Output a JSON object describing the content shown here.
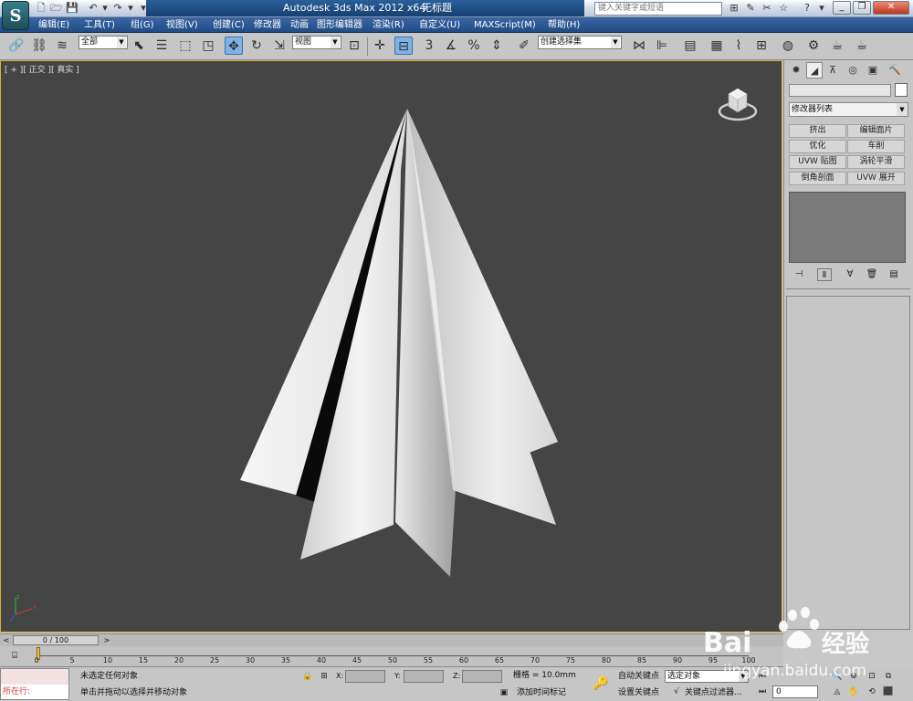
{
  "titlebar": {
    "app": "Autodesk 3ds Max  2012 x64",
    "file": "无标题",
    "search_placeholder": "键入关键字或短语"
  },
  "menu": [
    "编辑(E)",
    "工具(T)",
    "组(G)",
    "视图(V)",
    "创建(C)",
    "修改器",
    "动画",
    "图形编辑器",
    "渲染(R)",
    "自定义(U)",
    "MAXScript(M)",
    "帮助(H)"
  ],
  "toolbar": {
    "selection_filter": "全部",
    "ref_coord": "视图",
    "named_selection": "创建选择集",
    "snap_angle_label": "3"
  },
  "viewport": {
    "label": "[ + ][ 正交 ][ 真实 ]"
  },
  "command_panel": {
    "modifier_list": "修改器列表",
    "buttons": [
      "挤出",
      "编辑面片",
      "优化",
      "车削",
      "UVW 贴图",
      "涡轮平滑",
      "倒角剖面",
      "UVW 展开"
    ]
  },
  "timeline": {
    "frame_counter": "0 / 100",
    "ruler_labels": [
      "0",
      "5",
      "10",
      "15",
      "20",
      "25",
      "30",
      "35",
      "40",
      "45",
      "50",
      "55",
      "60",
      "65",
      "70",
      "75",
      "80",
      "85",
      "90",
      "95",
      "100"
    ]
  },
  "status": {
    "maxscript_label": "所在行:",
    "selection_msg": "未选定任何对象",
    "prompt_msg": "单击并拖动以选择并移动对象",
    "x_label": "X:",
    "y_label": "Y:",
    "z_label": "Z:",
    "grid": "栅格 = 10.0mm",
    "add_time_tag": "添加时间标记",
    "auto_key": "自动关键点",
    "set_key": "设置关键点",
    "auto_key_target": "选定对象",
    "key_filters": "关键点过滤器...",
    "frame": "0"
  },
  "watermark": {
    "brand": "Bai",
    "brand_cn": "经验",
    "url": "jingyan.baidu.com"
  },
  "colors": {
    "viewport_bg": "#454545",
    "viewport_border": "#d8b13d",
    "menubar": "#2c5a96",
    "panel": "#c6c6c6"
  }
}
